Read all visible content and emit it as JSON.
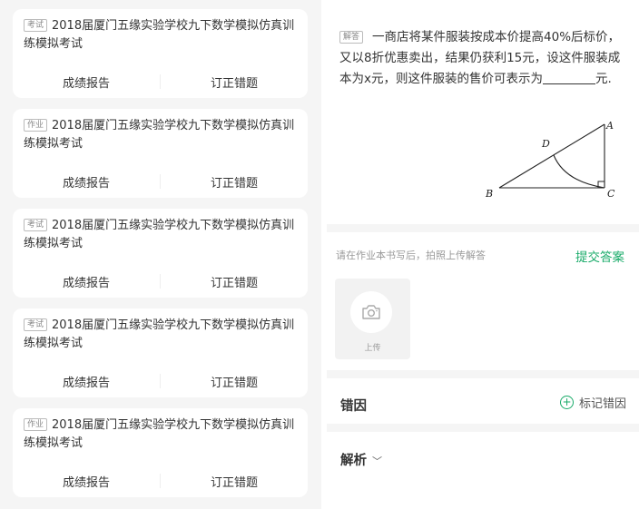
{
  "left": {
    "cards": [
      {
        "tag": "考试",
        "title": "2018届厦门五缘实验学校九下数学模拟仿真训练模拟考试",
        "report": "成绩报告",
        "correct": "订正错题"
      },
      {
        "tag": "作业",
        "title": "2018届厦门五缘实验学校九下数学模拟仿真训练模拟考试",
        "report": "成绩报告",
        "correct": "订正错题"
      },
      {
        "tag": "考试",
        "title": "2018届厦门五缘实验学校九下数学模拟仿真训练模拟考试",
        "report": "成绩报告",
        "correct": "订正错题"
      },
      {
        "tag": "考试",
        "title": "2018届厦门五缘实验学校九下数学模拟仿真训练模拟考试",
        "report": "成绩报告",
        "correct": "订正错题"
      },
      {
        "tag": "作业",
        "title": "2018届厦门五缘实验学校九下数学模拟仿真训练模拟考试",
        "report": "成绩报告",
        "correct": "订正错题"
      }
    ]
  },
  "right": {
    "question": {
      "tag": "解答",
      "text": "一商店将某件服装按成本价提高40%后标价，又以8折优惠卖出，结果仍获利15元，设这件服装成本为x元，则这件服装的售价可表示为",
      "suffix": "元."
    },
    "figure": {
      "labels": {
        "a": "A",
        "b": "B",
        "c": "C",
        "d": "D"
      }
    },
    "upload": {
      "hint": "请在作业本书写后，拍照上传解答",
      "submit": "提交答案",
      "label": "上传",
      "icon": "camera-icon"
    },
    "error_section": {
      "title": "错因",
      "mark": "标记错因",
      "icon": "plus-circle-icon"
    },
    "analysis_section": {
      "title": "解析",
      "icon": "chevron-down-icon"
    },
    "colors": {
      "accent": "#1aab6a"
    }
  }
}
